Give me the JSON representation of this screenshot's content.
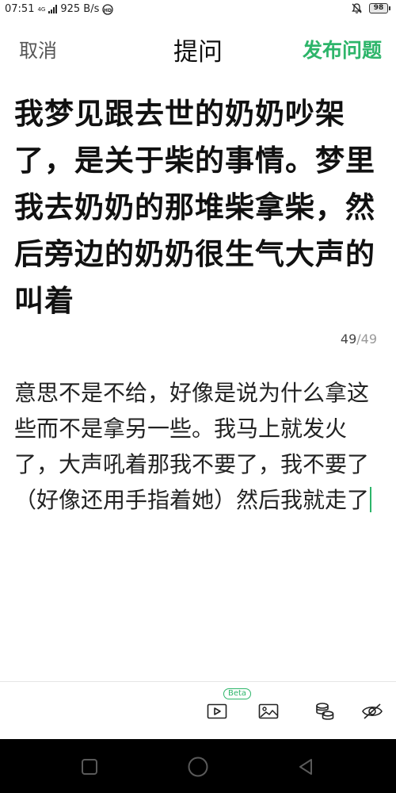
{
  "status_bar": {
    "time": "07:51",
    "network_type": "4G",
    "speed": "925 B/s",
    "battery": "98"
  },
  "header": {
    "cancel_label": "取消",
    "title": "提问",
    "publish_label": "发布问题"
  },
  "question": {
    "text": "我梦见跟去世的奶奶吵架了，是关于柴的事情。梦里我去奶奶的那堆柴拿柴，然后旁边的奶奶很生气大声的叫着",
    "count_current": "49",
    "count_separator": "/",
    "count_max": "49"
  },
  "description": {
    "text": "意思不是不给，好像是说为什么拿这些而不是拿另一些。我马上就发火了，大声吼着那我不要了，我不要了（好像还用手指着她）然后我就走了"
  },
  "toolbar": {
    "beta_label": "Beta",
    "tools": [
      "video-icon",
      "image-icon",
      "coins-icon",
      "hide-eye-icon"
    ]
  },
  "colors": {
    "accent": "#2db56a",
    "cancel": "#555555",
    "nav_background": "#000000"
  }
}
